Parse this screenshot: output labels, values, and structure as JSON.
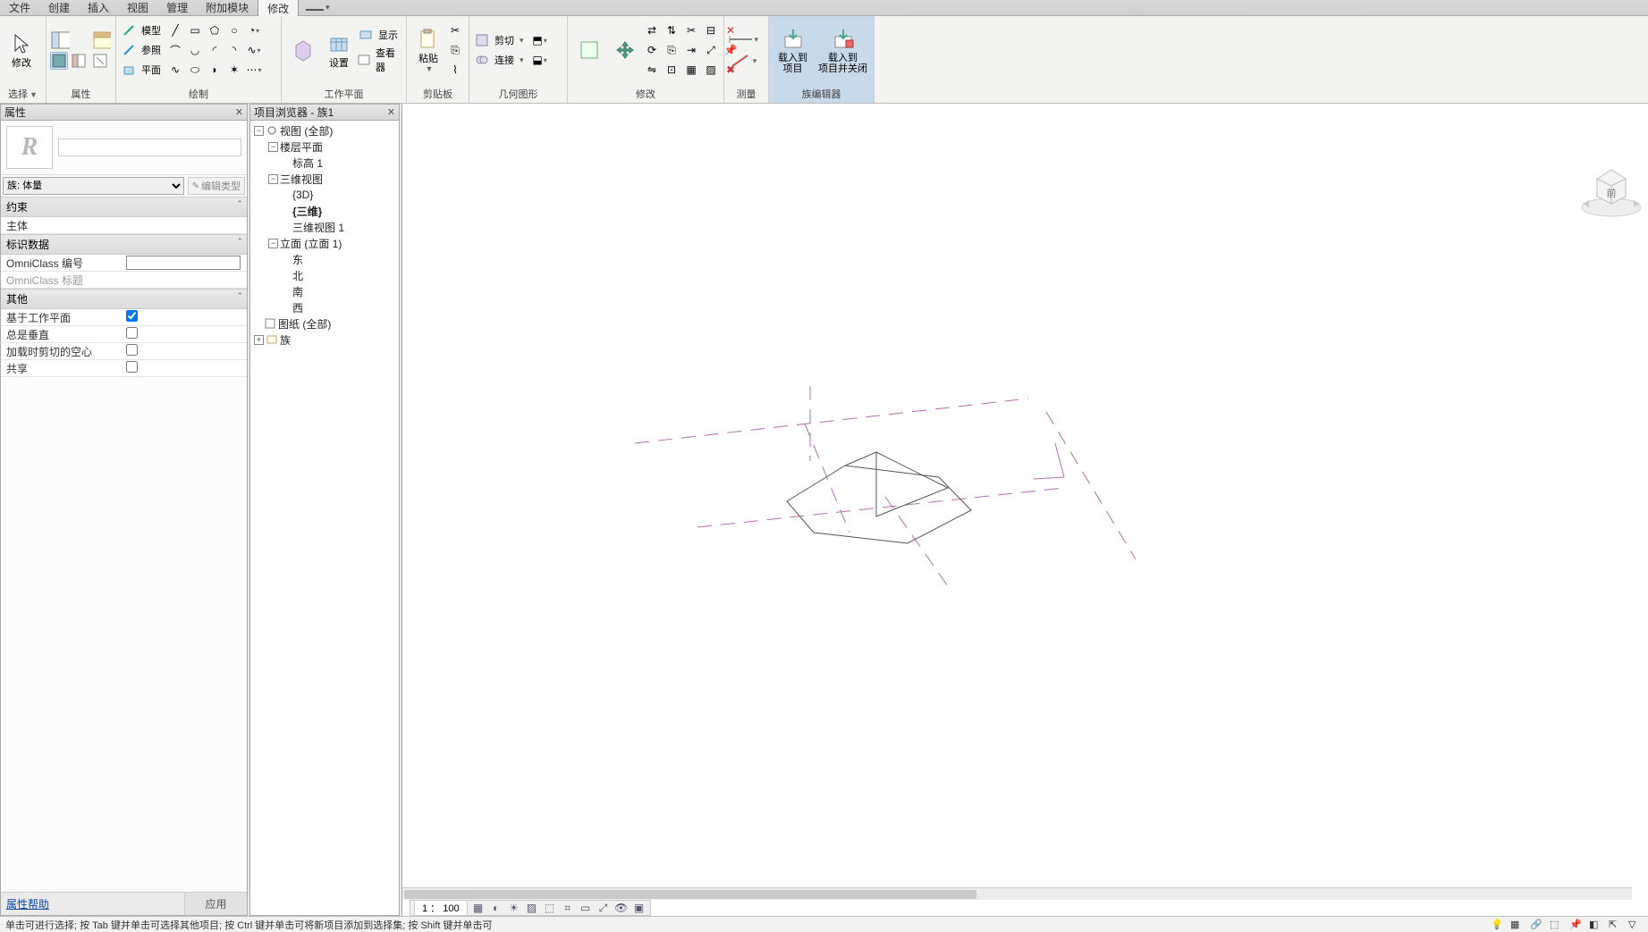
{
  "menu": {
    "items": [
      "文件",
      "创建",
      "插入",
      "视图",
      "管理",
      "附加模块",
      "修改"
    ],
    "active_index": 6
  },
  "ribbon": {
    "select": {
      "modify": "修改",
      "select_label": "选择"
    },
    "props": {
      "label": "属性"
    },
    "draw": {
      "label": "绘制",
      "model": "模型",
      "ref": "参照",
      "plane": "平面"
    },
    "workplane": {
      "label": "工作平面",
      "set": "设置",
      "show": "显示",
      "viewer": "查看器"
    },
    "clipboard": {
      "label": "剪贴板",
      "paste": "粘贴",
      "cut": "剪切",
      "connect": "连接"
    },
    "geometry": {
      "label": "几何图形"
    },
    "modify": {
      "label": "修改"
    },
    "measure": {
      "label": "测量"
    },
    "fam_editor": {
      "label": "族编辑器",
      "load_proj": "载入到\n项目",
      "load_close": "载入到\n项目并关闭"
    }
  },
  "properties_panel": {
    "title": "属性",
    "type_selector": "族: 体量",
    "edit_type": "编辑类型",
    "groups": [
      {
        "name": "约束",
        "rows": [
          {
            "k": "主体",
            "v": "",
            "type": "text"
          }
        ]
      },
      {
        "name": "标识数据",
        "rows": [
          {
            "k": "OmniClass 编号",
            "v": "",
            "type": "input"
          },
          {
            "k": "OmniClass 标题",
            "v": "",
            "type": "text",
            "dis": true
          }
        ]
      },
      {
        "name": "其他",
        "rows": [
          {
            "k": "基于工作平面",
            "v": true,
            "type": "check"
          },
          {
            "k": "总是垂直",
            "v": false,
            "type": "check"
          },
          {
            "k": "加载时剪切的空心",
            "v": false,
            "type": "check"
          },
          {
            "k": "共享",
            "v": false,
            "type": "check"
          }
        ]
      }
    ],
    "help": "属性帮助",
    "apply": "应用"
  },
  "browser": {
    "title": "项目浏览器 - 族1",
    "tree": [
      {
        "d": 0,
        "tog": "-",
        "ic": "views",
        "lbl": "视图 (全部)"
      },
      {
        "d": 1,
        "tog": "-",
        "ic": "",
        "lbl": "楼层平面"
      },
      {
        "d": 2,
        "tog": "",
        "ic": "",
        "lbl": "标高 1"
      },
      {
        "d": 1,
        "tog": "-",
        "ic": "",
        "lbl": "三维视图"
      },
      {
        "d": 2,
        "tog": "",
        "ic": "",
        "lbl": "{3D}"
      },
      {
        "d": 2,
        "tog": "",
        "ic": "",
        "lbl": "{三维}",
        "bold": true
      },
      {
        "d": 2,
        "tog": "",
        "ic": "",
        "lbl": "三维视图 1"
      },
      {
        "d": 1,
        "tog": "-",
        "ic": "",
        "lbl": "立面 (立面 1)"
      },
      {
        "d": 2,
        "tog": "",
        "ic": "",
        "lbl": "东"
      },
      {
        "d": 2,
        "tog": "",
        "ic": "",
        "lbl": "北"
      },
      {
        "d": 2,
        "tog": "",
        "ic": "",
        "lbl": "南"
      },
      {
        "d": 2,
        "tog": "",
        "ic": "",
        "lbl": "西"
      },
      {
        "d": 0,
        "tog": "",
        "ic": "sheets",
        "lbl": "图纸 (全部)"
      },
      {
        "d": 0,
        "tog": "+",
        "ic": "fam",
        "lbl": "族"
      }
    ]
  },
  "viewcube": {
    "face": "前"
  },
  "viewbar": {
    "scale": "1 ： 100"
  },
  "status": {
    "text": "单击可进行选择; 按 Tab 键并单击可选择其他项目; 按 Ctrl 键并单击可将新项目添加到选择集; 按 Shift 键并单击可"
  }
}
